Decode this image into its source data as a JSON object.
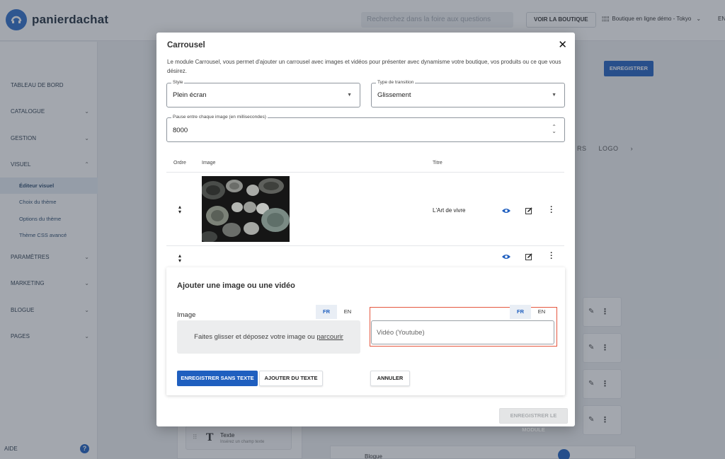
{
  "brand": {
    "name": "panierdachat"
  },
  "topbar": {
    "search_placeholder": "Recherchez dans la foire aux questions",
    "store_button": "VOIR LA BOUTIQUE",
    "shop_name": "Boutique en ligne démo - Tokyo",
    "language": "EN"
  },
  "sidebar": {
    "items": [
      {
        "label": "TABLEAU DE BORD"
      },
      {
        "label": "CATALOGUE"
      },
      {
        "label": "GESTION"
      },
      {
        "label": "VISUEL"
      },
      {
        "label": "PARAMÈTRES"
      },
      {
        "label": "MARKETING"
      },
      {
        "label": "BLOGUE"
      },
      {
        "label": "PAGES"
      }
    ],
    "visuel_sub": [
      "Éditeur visuel",
      "Choix du thème",
      "Options du thème",
      "Thème CSS avancé"
    ],
    "help": "AIDE"
  },
  "background": {
    "save_button": "ENREGISTRER",
    "tabs": [
      "RS",
      "LOGO",
      "›"
    ],
    "texte_card": {
      "title": "Texte",
      "subtitle": "Insérez un champ texte"
    },
    "blogue_label": "Blogue"
  },
  "modal": {
    "title": "Carrousel",
    "description": "Le module Carrousel, vous permet d'ajouter un carrousel avec images et vidéos pour présenter avec dynamisme votre boutique, vos produits ou ce que vous désirez.",
    "style": {
      "label": "Style",
      "value": "Plein écran"
    },
    "transition": {
      "label": "Type de transition",
      "value": "Glissement"
    },
    "pause": {
      "label": "Pause entre chaque image (en millisecondes)",
      "value": "8000"
    },
    "table": {
      "headers": {
        "order": "Ordre",
        "image": "Image",
        "title": "Titre"
      },
      "rows": [
        {
          "title": "L'Art de vivre"
        },
        {
          "title": ""
        }
      ]
    },
    "add_panel": {
      "title": "Ajouter une image ou une vidéo",
      "image_label": "Image",
      "langs": [
        "FR",
        "EN"
      ],
      "drop_text": "Faites glisser et déposez votre image ou",
      "drop_link": "parcourir",
      "video_placeholder": "Vidéo (Youtube)",
      "save_no_text": "ENREGISTRER SANS TEXTE",
      "add_text": "AJOUTER DU TEXTE",
      "cancel": "ANNULER"
    },
    "save_module": "ENREGISTRER LE MODULE"
  },
  "colors": {
    "accent": "#1f5fbf",
    "highlight": "#e5573f"
  }
}
